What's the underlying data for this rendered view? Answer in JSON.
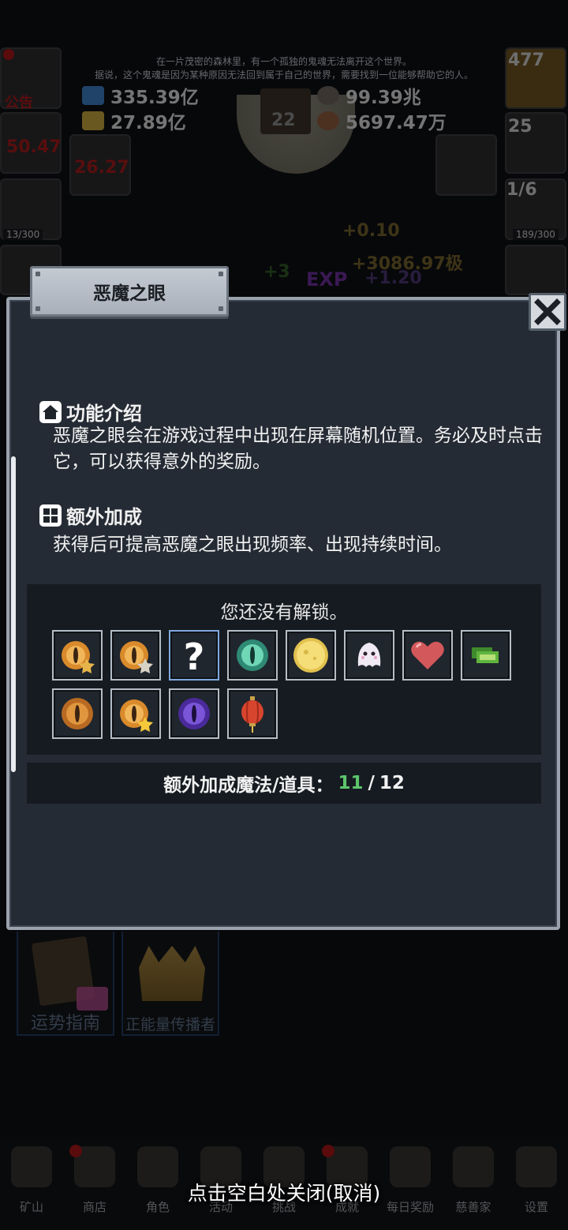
{
  "story": {
    "line1": "在一片茂密的森林里，有一个孤独的鬼魂无法离开这个世界。",
    "line2": "据说，这个鬼魂是因为某种原因无法回到属于自己的世界，需要找到一位能够帮助它的人。"
  },
  "resources": {
    "blue_potion": "335.39亿",
    "yellow_potion": "27.89亿",
    "stone": "99.39兆",
    "meat": "5697.47万",
    "book_count": "22"
  },
  "side_tiles": {
    "notice_label": "公告",
    "torch_value": "50.47",
    "trophy_value": "26.27",
    "capacity_left": "13/300",
    "potion_count": "477",
    "chest_count": "25",
    "slime_progress": "1/6",
    "capacity_right": "189/300"
  },
  "floating": {
    "gain_small": "+0.10",
    "gain_big": "+3086.97极",
    "plus3": "+3",
    "exp_label": "EXP",
    "exp_gain": "+1.20"
  },
  "dialog": {
    "title": "恶魔之眼",
    "intro_heading": "功能介绍",
    "intro_text": "恶魔之眼会在游戏过程中出现在屏幕随机位置。务必及时点击它，可以获得意外的奖励。",
    "bonus_heading": "额外加成",
    "bonus_text": "获得后可提高恶魔之眼出现频率、出现持续时间。",
    "locked_text": "您还没有解锁。",
    "count_label": "额外加成魔法/道具：",
    "count_have": "11",
    "count_sep": "/",
    "count_total": "12",
    "items": [
      "golden-eye-star-icon",
      "golden-eye-silver-star-icon",
      "question-mark-icon",
      "green-eye-icon",
      "gold-coin-icon",
      "ghost-icon",
      "heart-icon",
      "cash-icon",
      "brown-eye-icon",
      "golden-eye-gold-star-icon",
      "purple-eye-icon",
      "red-lantern-icon"
    ]
  },
  "bottom_cards": {
    "fortune": "运势指南",
    "positive": "正能量传播者"
  },
  "close_hint": "点击空白处关闭(取消)",
  "nav": [
    "矿山",
    "商店",
    "角色",
    "活动",
    "挑战",
    "成就",
    "每日奖励",
    "慈善家",
    "设置"
  ],
  "colors": {
    "panel_bg": "#252b34",
    "panel_border": "#9aa2ad",
    "count_green": "#5ec46c",
    "alert_red": "#a41515"
  }
}
